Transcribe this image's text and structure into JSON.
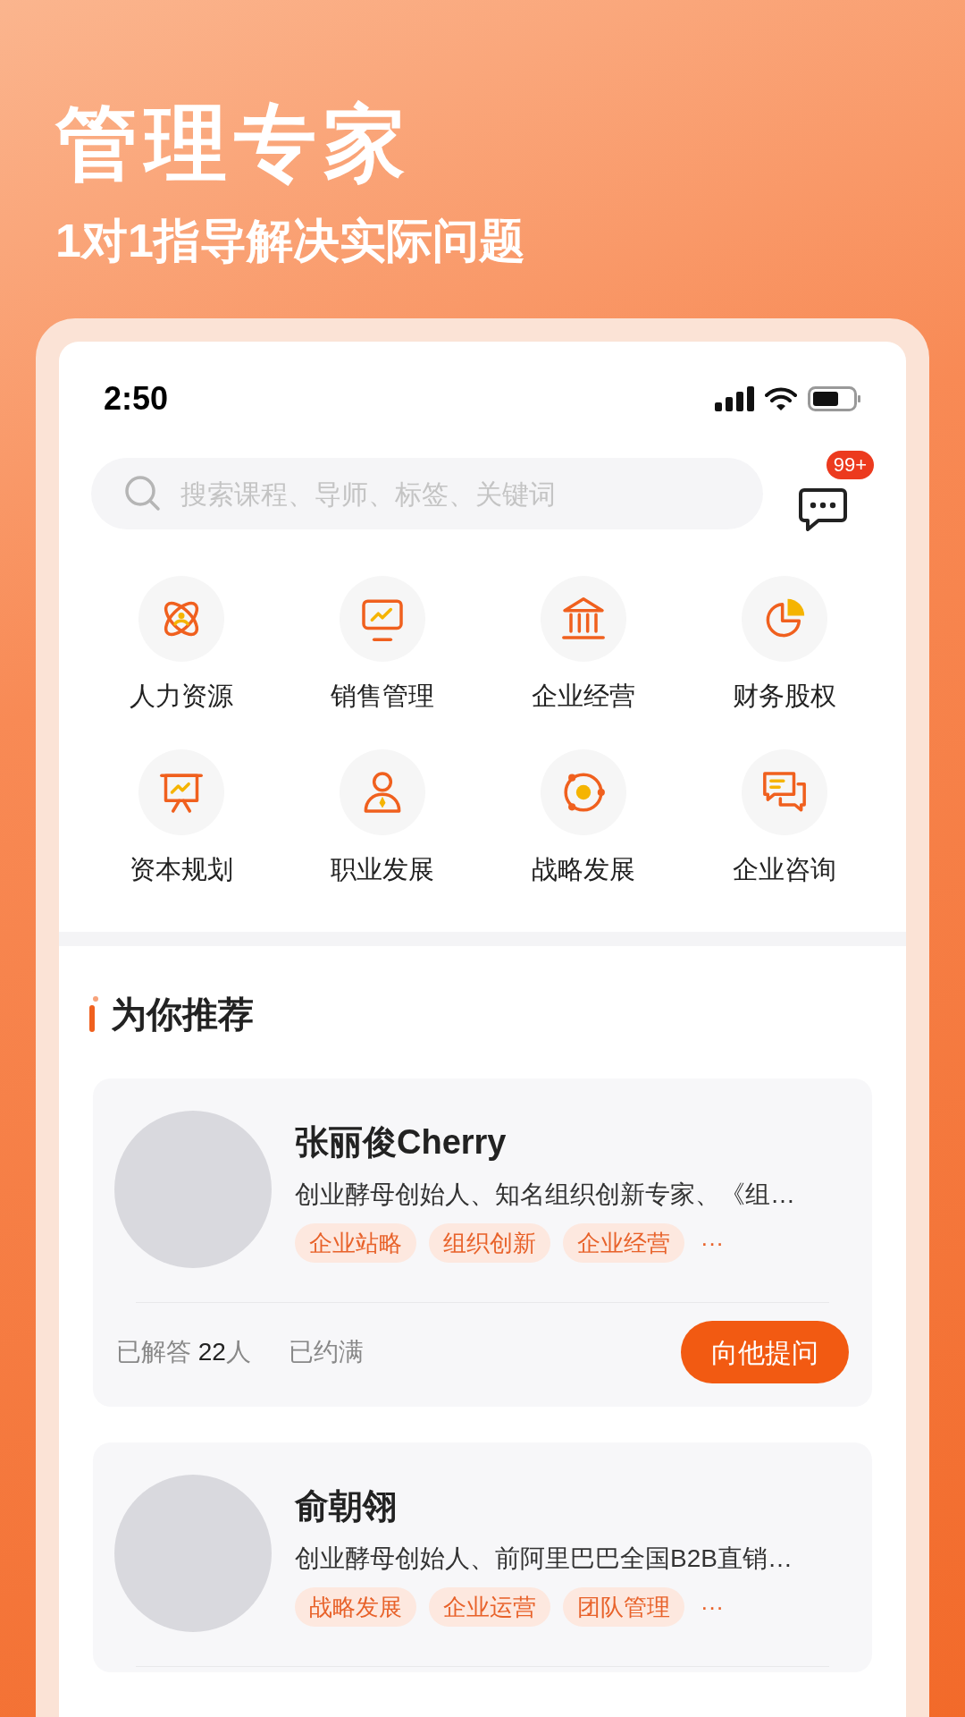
{
  "headline": "管理专家",
  "subtitle": "1对1指导解决实际问题",
  "phone": {
    "status_bar": {
      "time": "2:50"
    },
    "search": {
      "placeholder": "搜索课程、导师、标签、关键词"
    },
    "messages": {
      "badge": "99+"
    },
    "categories": [
      {
        "label": "人力资源",
        "kind": "atom"
      },
      {
        "label": "销售管理",
        "kind": "monitor"
      },
      {
        "label": "企业经营",
        "kind": "bank"
      },
      {
        "label": "财务股权",
        "kind": "pie"
      },
      {
        "label": "资本规划",
        "kind": "easel"
      },
      {
        "label": "职业发展",
        "kind": "person"
      },
      {
        "label": "战略发展",
        "kind": "orbit"
      },
      {
        "label": "企业咨询",
        "kind": "chat"
      }
    ],
    "section_title": "为你推荐",
    "experts": [
      {
        "name": "张丽俊Cherry",
        "bio": "创业酵母创始人、知名组织创新专家、《组…",
        "tags": [
          "企业站略",
          "组织创新",
          "企业经营"
        ],
        "more": "···",
        "answered_label": "已解答",
        "answered_count": "22",
        "answered_unit": "人",
        "status": "已约满",
        "button": "向他提问"
      },
      {
        "name": "俞朝翎",
        "bio": "创业酵母创始人、前阿里巴巴全国B2B直销…",
        "tags": [
          "战略发展",
          "企业运营",
          "团队管理"
        ],
        "more": "···"
      }
    ]
  }
}
